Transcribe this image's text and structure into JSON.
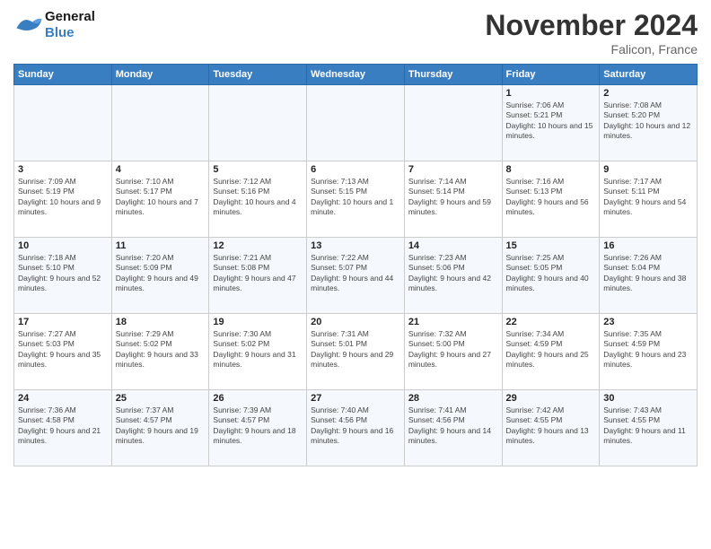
{
  "header": {
    "logo_text_general": "General",
    "logo_text_blue": "Blue",
    "month_title": "November 2024",
    "location": "Falicon, France"
  },
  "calendar": {
    "days_of_week": [
      "Sunday",
      "Monday",
      "Tuesday",
      "Wednesday",
      "Thursday",
      "Friday",
      "Saturday"
    ],
    "weeks": [
      [
        {
          "day": "",
          "info": ""
        },
        {
          "day": "",
          "info": ""
        },
        {
          "day": "",
          "info": ""
        },
        {
          "day": "",
          "info": ""
        },
        {
          "day": "",
          "info": ""
        },
        {
          "day": "1",
          "info": "Sunrise: 7:06 AM\nSunset: 5:21 PM\nDaylight: 10 hours and 15 minutes."
        },
        {
          "day": "2",
          "info": "Sunrise: 7:08 AM\nSunset: 5:20 PM\nDaylight: 10 hours and 12 minutes."
        }
      ],
      [
        {
          "day": "3",
          "info": "Sunrise: 7:09 AM\nSunset: 5:19 PM\nDaylight: 10 hours and 9 minutes."
        },
        {
          "day": "4",
          "info": "Sunrise: 7:10 AM\nSunset: 5:17 PM\nDaylight: 10 hours and 7 minutes."
        },
        {
          "day": "5",
          "info": "Sunrise: 7:12 AM\nSunset: 5:16 PM\nDaylight: 10 hours and 4 minutes."
        },
        {
          "day": "6",
          "info": "Sunrise: 7:13 AM\nSunset: 5:15 PM\nDaylight: 10 hours and 1 minute."
        },
        {
          "day": "7",
          "info": "Sunrise: 7:14 AM\nSunset: 5:14 PM\nDaylight: 9 hours and 59 minutes."
        },
        {
          "day": "8",
          "info": "Sunrise: 7:16 AM\nSunset: 5:13 PM\nDaylight: 9 hours and 56 minutes."
        },
        {
          "day": "9",
          "info": "Sunrise: 7:17 AM\nSunset: 5:11 PM\nDaylight: 9 hours and 54 minutes."
        }
      ],
      [
        {
          "day": "10",
          "info": "Sunrise: 7:18 AM\nSunset: 5:10 PM\nDaylight: 9 hours and 52 minutes."
        },
        {
          "day": "11",
          "info": "Sunrise: 7:20 AM\nSunset: 5:09 PM\nDaylight: 9 hours and 49 minutes."
        },
        {
          "day": "12",
          "info": "Sunrise: 7:21 AM\nSunset: 5:08 PM\nDaylight: 9 hours and 47 minutes."
        },
        {
          "day": "13",
          "info": "Sunrise: 7:22 AM\nSunset: 5:07 PM\nDaylight: 9 hours and 44 minutes."
        },
        {
          "day": "14",
          "info": "Sunrise: 7:23 AM\nSunset: 5:06 PM\nDaylight: 9 hours and 42 minutes."
        },
        {
          "day": "15",
          "info": "Sunrise: 7:25 AM\nSunset: 5:05 PM\nDaylight: 9 hours and 40 minutes."
        },
        {
          "day": "16",
          "info": "Sunrise: 7:26 AM\nSunset: 5:04 PM\nDaylight: 9 hours and 38 minutes."
        }
      ],
      [
        {
          "day": "17",
          "info": "Sunrise: 7:27 AM\nSunset: 5:03 PM\nDaylight: 9 hours and 35 minutes."
        },
        {
          "day": "18",
          "info": "Sunrise: 7:29 AM\nSunset: 5:02 PM\nDaylight: 9 hours and 33 minutes."
        },
        {
          "day": "19",
          "info": "Sunrise: 7:30 AM\nSunset: 5:02 PM\nDaylight: 9 hours and 31 minutes."
        },
        {
          "day": "20",
          "info": "Sunrise: 7:31 AM\nSunset: 5:01 PM\nDaylight: 9 hours and 29 minutes."
        },
        {
          "day": "21",
          "info": "Sunrise: 7:32 AM\nSunset: 5:00 PM\nDaylight: 9 hours and 27 minutes."
        },
        {
          "day": "22",
          "info": "Sunrise: 7:34 AM\nSunset: 4:59 PM\nDaylight: 9 hours and 25 minutes."
        },
        {
          "day": "23",
          "info": "Sunrise: 7:35 AM\nSunset: 4:59 PM\nDaylight: 9 hours and 23 minutes."
        }
      ],
      [
        {
          "day": "24",
          "info": "Sunrise: 7:36 AM\nSunset: 4:58 PM\nDaylight: 9 hours and 21 minutes."
        },
        {
          "day": "25",
          "info": "Sunrise: 7:37 AM\nSunset: 4:57 PM\nDaylight: 9 hours and 19 minutes."
        },
        {
          "day": "26",
          "info": "Sunrise: 7:39 AM\nSunset: 4:57 PM\nDaylight: 9 hours and 18 minutes."
        },
        {
          "day": "27",
          "info": "Sunrise: 7:40 AM\nSunset: 4:56 PM\nDaylight: 9 hours and 16 minutes."
        },
        {
          "day": "28",
          "info": "Sunrise: 7:41 AM\nSunset: 4:56 PM\nDaylight: 9 hours and 14 minutes."
        },
        {
          "day": "29",
          "info": "Sunrise: 7:42 AM\nSunset: 4:55 PM\nDaylight: 9 hours and 13 minutes."
        },
        {
          "day": "30",
          "info": "Sunrise: 7:43 AM\nSunset: 4:55 PM\nDaylight: 9 hours and 11 minutes."
        }
      ]
    ]
  }
}
